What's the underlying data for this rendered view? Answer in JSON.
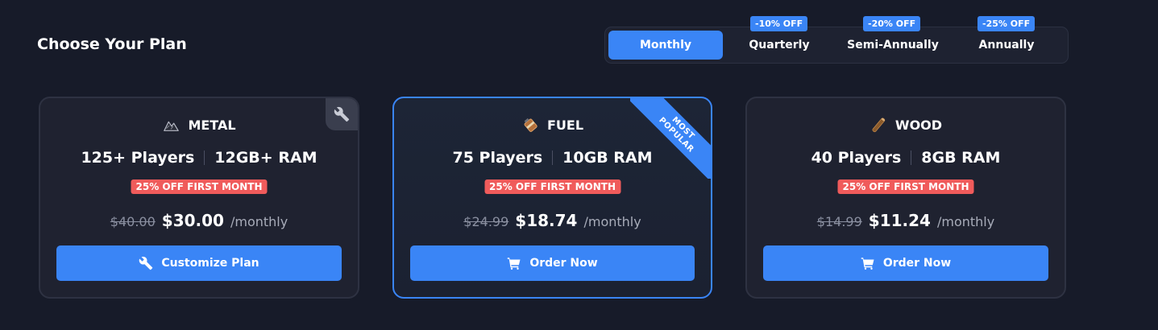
{
  "header": {
    "title": "Choose Your Plan"
  },
  "billing": {
    "periods": [
      {
        "label": "Monthly",
        "active": true,
        "discount": ""
      },
      {
        "label": "Quarterly",
        "active": false,
        "discount": "-10% OFF"
      },
      {
        "label": "Semi-Annually",
        "active": false,
        "discount": "-20% OFF"
      },
      {
        "label": "Annually",
        "active": false,
        "discount": "-25% OFF"
      }
    ]
  },
  "plans": [
    {
      "name": "METAL",
      "icon": "metal-ore-icon",
      "players": "125+ Players",
      "ram": "12GB+ RAM",
      "promo": "25% OFF FIRST MONTH",
      "old_price": "$40.00",
      "price": "$30.00",
      "period": "/monthly",
      "cta": "Customize Plan",
      "cta_icon": "wrench-icon",
      "corner_icon": "wrench-icon"
    },
    {
      "name": "FUEL",
      "icon": "fuel-icon",
      "players": "75 Players",
      "ram": "10GB RAM",
      "promo": "25% OFF FIRST MONTH",
      "old_price": "$24.99",
      "price": "$18.74",
      "period": "/monthly",
      "cta": "Order Now",
      "cta_icon": "cart-icon",
      "ribbon": [
        "MOST",
        "POPULAR"
      ],
      "featured": true
    },
    {
      "name": "WOOD",
      "icon": "wood-log-icon",
      "players": "40 Players",
      "ram": "8GB RAM",
      "promo": "25% OFF FIRST MONTH",
      "old_price": "$14.99",
      "price": "$11.24",
      "period": "/monthly",
      "cta": "Order Now",
      "cta_icon": "cart-icon"
    }
  ],
  "colors": {
    "background": "#171b29",
    "card": "#1f2230",
    "accent": "#3a85f6",
    "promo": "#f05b5b",
    "muted": "#8a8fa0"
  }
}
